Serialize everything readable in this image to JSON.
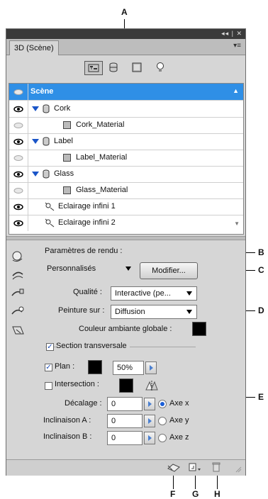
{
  "callouts": {
    "a": "A",
    "b": "B",
    "c": "C",
    "d": "D",
    "e": "E",
    "f": "F",
    "g": "G",
    "h": "H"
  },
  "panel": {
    "title_buttons": "◂◂ | ✕",
    "tab_label": "3D (Scène)",
    "tab_menu": "▾≡"
  },
  "toolbar_icons": [
    "scene-filter-icon",
    "mesh-filter-icon",
    "material-filter-icon",
    "light-filter-icon"
  ],
  "scene_list": {
    "rows": [
      {
        "label": "Scène",
        "type": "scene"
      },
      {
        "label": "Cork",
        "type": "mesh"
      },
      {
        "label": "Cork_Material",
        "type": "material"
      },
      {
        "label": "Label",
        "type": "mesh"
      },
      {
        "label": "Label_Material",
        "type": "material"
      },
      {
        "label": "Glass",
        "type": "mesh"
      },
      {
        "label": "Glass_Material",
        "type": "material"
      },
      {
        "label": "Eclairage infini 1",
        "type": "light"
      },
      {
        "label": "Eclairage infini 2",
        "type": "light"
      }
    ]
  },
  "render": {
    "settings_label": "Paramètres de rendu :",
    "preset_value": "Personnalisés",
    "modify_button": "Modifier...",
    "quality_label": "Qualité :",
    "quality_value": "Interactive (pe...",
    "paint_label": "Peinture sur :",
    "paint_value": "Diffusion",
    "ambient_label": "Couleur ambiante globale :",
    "ambient_color": "#000000"
  },
  "cross_section": {
    "label": "Section transversale",
    "checked": true,
    "plane_label": "Plan :",
    "plane_checked": true,
    "plane_color": "#000000",
    "plane_opacity": "50%",
    "intersection_label": "Intersection :",
    "intersection_checked": false,
    "intersection_color": "#000000",
    "offset_label": "Décalage :",
    "offset_value": "0",
    "tilt_a_label": "Inclinaison A :",
    "tilt_a_value": "0",
    "tilt_b_label": "Inclinaison B :",
    "tilt_b_value": "0",
    "axis_x": "Axe x",
    "axis_y": "Axe y",
    "axis_z": "Axe z",
    "selected_axis": "x"
  },
  "colors": {
    "selection": "#2f8fe6",
    "accent_blue": "#1a5ed6"
  }
}
